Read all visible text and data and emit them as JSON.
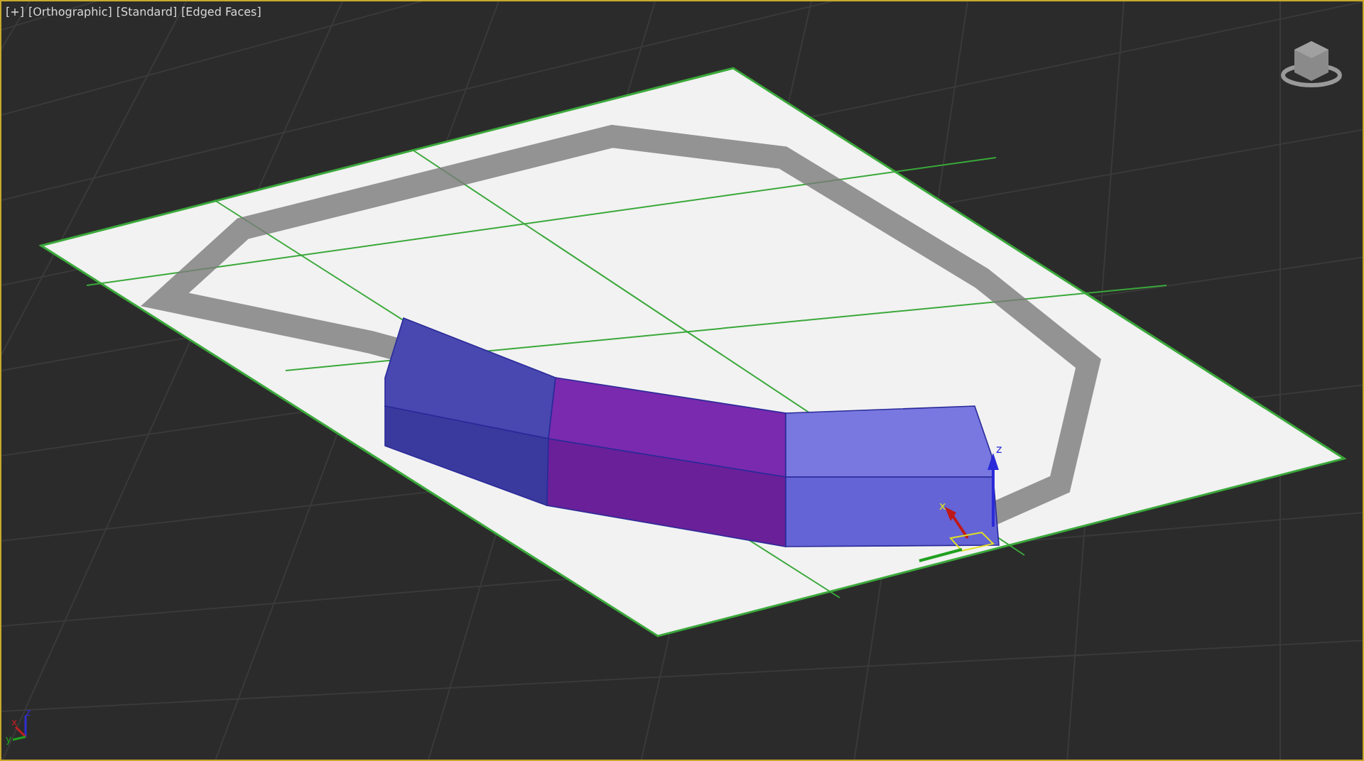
{
  "viewport": {
    "active": true,
    "labels": [
      "[+]",
      "[Orthographic]",
      "[Standard]",
      "[Edged Faces]"
    ]
  },
  "axis_tripod": {
    "labels": [
      "z",
      "x",
      "y"
    ]
  },
  "gizmo": {
    "labels": [
      "z",
      "x"
    ]
  }
}
